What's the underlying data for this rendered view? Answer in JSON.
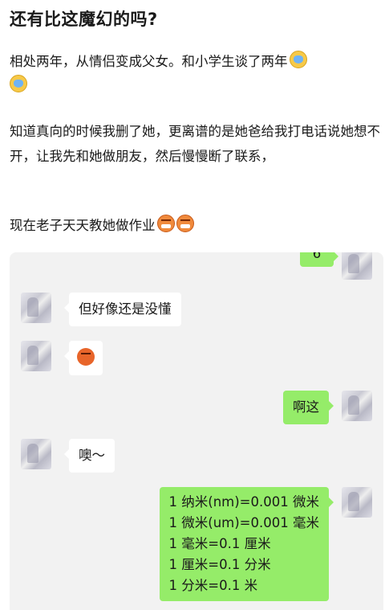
{
  "post": {
    "title": "还有比这魔幻的吗?",
    "para1": "相处两年，从情侣变成父女。和小学生谈了两年",
    "para2": "知道真向的时候我删了她，更离谱的是她爸给我打电话说她想不开，让我先和她做朋友，然后慢慢断了联系，",
    "para3": "现在老子天天教她做作业",
    "emoji_cry": "crying-face-emoji",
    "emoji_angry": "angry-face-emoji"
  },
  "chat": {
    "msg_top_partial": "6",
    "msg1": "但好像还是没懂",
    "msg2_emoji": "orange-face-emoji",
    "msg3": "啊这",
    "msg4": "噢～",
    "conversion_lines": [
      "1 纳米(nm)=0.001 微米",
      "1 微米(um)=0.001 毫米",
      "1 毫米=0.1 厘米",
      "1 厘米=0.1 分米",
      "1 分米=0.1 米"
    ],
    "colors": {
      "chat_bg": "#f2f2f2",
      "bubble_out": "#95ec69",
      "bubble_in": "#ffffff"
    }
  }
}
